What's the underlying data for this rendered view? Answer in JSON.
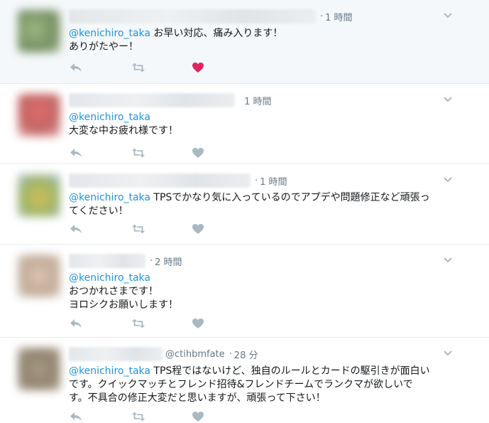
{
  "tweets": [
    {
      "time": "1 時間",
      "mention": "@kenichiro_taka",
      "text": " お早い対応、痛み入ります！\nありがたやー！",
      "liked": true
    },
    {
      "time": "1 時間",
      "mention": "@kenichiro_taka",
      "text": "\n大変な中お疲れ様です！",
      "liked": false
    },
    {
      "time": "1 時間",
      "mention": "@kenichiro_taka",
      "text": " TPSでかなり気に入っているのでアプデや問題修正など頑張っ\nてください！",
      "liked": false
    },
    {
      "time": "2 時間",
      "mention": "@kenichiro_taka",
      "text": "\nおつかれさまです！\nヨロシクお願いします！",
      "liked": false
    },
    {
      "handle": "@ctihbmfate",
      "time": "28 分",
      "mention": "@kenichiro_taka",
      "text": " TPS程ではないけど、独自のルールとカードの駆引きが面白い\nです。クイックマッチとフレンド招待&フレンドチームでランクマが欲しいで\nす。不具合の修正大変だと思いますが、頑張って下さい！",
      "liked": false
    }
  ],
  "colors": {
    "accent": "#1b95e0",
    "like_active": "#e0245e",
    "icon": "#aab8c2",
    "meta": "#657786"
  },
  "icons": [
    "reply-icon",
    "retweet-icon",
    "heart-icon",
    "chevron-down-icon"
  ]
}
